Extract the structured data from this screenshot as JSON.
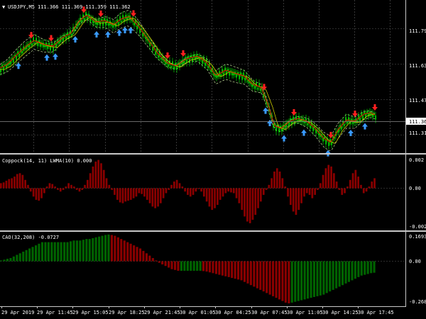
{
  "header": {
    "symbol_label": "USDJPY,M5",
    "prices": "111.366 111.369 111.359 111.362"
  },
  "current_price": "111.362",
  "main_axis": [
    "111.790",
    "111.630",
    "111.470",
    "111.310"
  ],
  "coppock": {
    "title": "Coppock(14, 11) LWMA(10) 0.000",
    "axis": [
      "0.002",
      "0.00",
      "-0.002"
    ],
    "values": [
      0.3,
      0.35,
      0.45,
      0.55,
      0.6,
      0.7,
      0.85,
      0.9,
      0.8,
      0.5,
      0.2,
      -0.2,
      -0.5,
      -0.7,
      -0.75,
      -0.6,
      -0.3,
      0.1,
      0.3,
      0.25,
      0.1,
      -0.1,
      -0.2,
      -0.1,
      0.1,
      0.3,
      0.2,
      0.1,
      -0.1,
      -0.2,
      -0.1,
      0.2,
      0.5,
      0.9,
      1.3,
      1.6,
      1.7,
      1.5,
      1.1,
      0.6,
      0.2,
      -0.1,
      -0.4,
      -0.7,
      -0.85,
      -0.9,
      -0.8,
      -0.75,
      -0.7,
      -0.6,
      -0.5,
      -0.3,
      -0.35,
      -0.5,
      -0.7,
      -0.9,
      -1.1,
      -1.2,
      -1.1,
      -0.9,
      -0.6,
      -0.3,
      -0.1,
      0.2,
      0.4,
      0.5,
      0.3,
      0.1,
      -0.2,
      -0.4,
      -0.5,
      -0.4,
      -0.2,
      -0.05,
      -0.2,
      -0.5,
      -0.8,
      -1.1,
      -1.3,
      -1.2,
      -1.0,
      -0.7,
      -0.5,
      -0.3,
      -0.2,
      -0.25,
      -0.3,
      -0.6,
      -0.9,
      -1.3,
      -1.7,
      -2.0,
      -2.1,
      -1.9,
      -1.6,
      -1.2,
      -0.8,
      -0.4,
      -0.1,
      0.2,
      0.6,
      1.0,
      1.2,
      1.0,
      0.6,
      0.1,
      -0.5,
      -1.0,
      -1.4,
      -1.6,
      -1.3,
      -0.9,
      -0.5,
      -0.3,
      -0.4,
      -0.6,
      -0.4,
      -0.1,
      0.3,
      0.8,
      1.2,
      1.4,
      1.3,
      0.9,
      0.4,
      -0.1,
      -0.4,
      -0.3,
      0.1,
      0.5,
      0.9,
      1.1,
      0.7,
      0.2,
      -0.3,
      -0.2,
      0.1,
      0.4,
      0.6
    ],
    "colors": {
      "pos": "#8b0000",
      "neg": "#8b0000"
    }
  },
  "cao": {
    "title": "CAO(32,208) -0.0727",
    "axis": [
      "0.1693",
      "0.00",
      "-0.2681"
    ],
    "values": [
      0.005,
      0.01,
      0.015,
      0.02,
      0.03,
      0.04,
      0.05,
      0.06,
      0.07,
      0.08,
      0.09,
      0.1,
      0.11,
      0.12,
      0.12,
      0.12,
      0.12,
      0.12,
      0.12,
      0.12,
      0.12,
      0.12,
      0.125,
      0.13,
      0.13,
      0.13,
      0.135,
      0.14,
      0.14,
      0.145,
      0.15,
      0.155,
      0.16,
      0.165,
      0.168,
      0.165,
      0.16,
      0.15,
      0.14,
      0.13,
      0.12,
      0.11,
      0.1,
      0.09,
      0.08,
      0.065,
      0.05,
      0.035,
      0.02,
      0.005,
      -0.01,
      -0.02,
      -0.03,
      -0.04,
      -0.05,
      -0.055,
      -0.06,
      -0.06,
      -0.06,
      -0.06,
      -0.06,
      -0.06,
      -0.06,
      -0.06,
      -0.062,
      -0.065,
      -0.07,
      -0.075,
      -0.08,
      -0.085,
      -0.09,
      -0.095,
      -0.1,
      -0.105,
      -0.11,
      -0.115,
      -0.12,
      -0.13,
      -0.14,
      -0.15,
      -0.16,
      -0.17,
      -0.18,
      -0.19,
      -0.2,
      -0.21,
      -0.22,
      -0.23,
      -0.24,
      -0.25,
      -0.26,
      -0.265,
      -0.26,
      -0.255,
      -0.25,
      -0.245,
      -0.24,
      -0.235,
      -0.23,
      -0.225,
      -0.22,
      -0.215,
      -0.21,
      -0.2,
      -0.19,
      -0.18,
      -0.17,
      -0.16,
      -0.15,
      -0.14,
      -0.13,
      -0.12,
      -0.11,
      -0.1,
      -0.09,
      -0.085,
      -0.08,
      -0.075,
      -0.072
    ],
    "colors": {
      "up": "#006400",
      "down": "#8b0000"
    }
  },
  "time_axis": [
    "29 Apr 2019",
    "29 Apr 11:45",
    "29 Apr 15:05",
    "29 Apr 18:25",
    "29 Apr 21:45",
    "30 Apr 01:05",
    "30 Apr 04:25",
    "30 Apr 07:45",
    "30 Apr 11:05",
    "30 Apr 14:25",
    "30 Apr 17:45"
  ],
  "colors": {
    "background": "#000000",
    "candle": "#00ff00",
    "ma_red": "#ff0000",
    "ma_yellow": "#c8c800",
    "band": "#e0ffb0",
    "arrow_up": "#3a9bff",
    "arrow_down": "#ff2020",
    "grid": "#5a5a5a"
  }
}
